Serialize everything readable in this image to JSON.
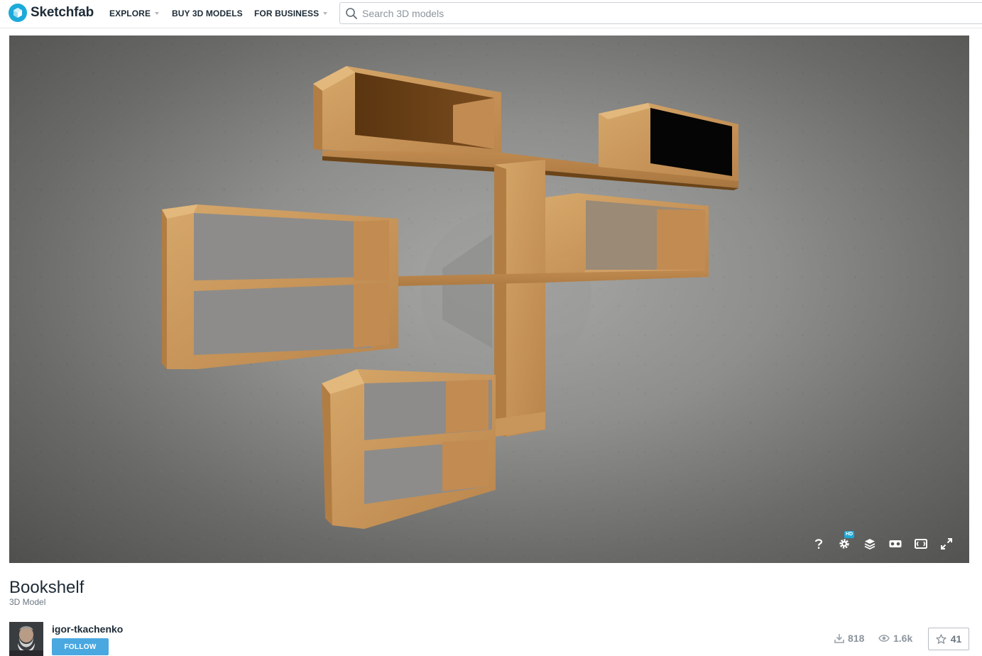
{
  "header": {
    "logo_text": "Sketchfab",
    "nav": [
      {
        "label": "EXPLORE",
        "has_caret": true
      },
      {
        "label": "BUY 3D MODELS",
        "has_caret": false
      },
      {
        "label": "FOR BUSINESS",
        "has_caret": true
      }
    ],
    "search": {
      "placeholder": "Search 3D models",
      "value": ""
    }
  },
  "viewer": {
    "controls": [
      {
        "icon": "help-icon",
        "label": "?"
      },
      {
        "icon": "settings-icon",
        "badge": "HD"
      },
      {
        "icon": "layers-icon"
      },
      {
        "icon": "vr-icon"
      },
      {
        "icon": "theater-mode-icon"
      },
      {
        "icon": "fullscreen-icon"
      }
    ]
  },
  "model": {
    "title": "Bookshelf",
    "type": "3D Model"
  },
  "author": {
    "name": "igor-tkachenko",
    "follow_label": "FOLLOW"
  },
  "stats": {
    "downloads": "818",
    "views": "1.6k",
    "likes": "41"
  },
  "colors": {
    "brand": "#1caad9",
    "follow_button": "#4aa8e0",
    "text_dark": "#1d2b36",
    "muted": "#8c959d"
  }
}
